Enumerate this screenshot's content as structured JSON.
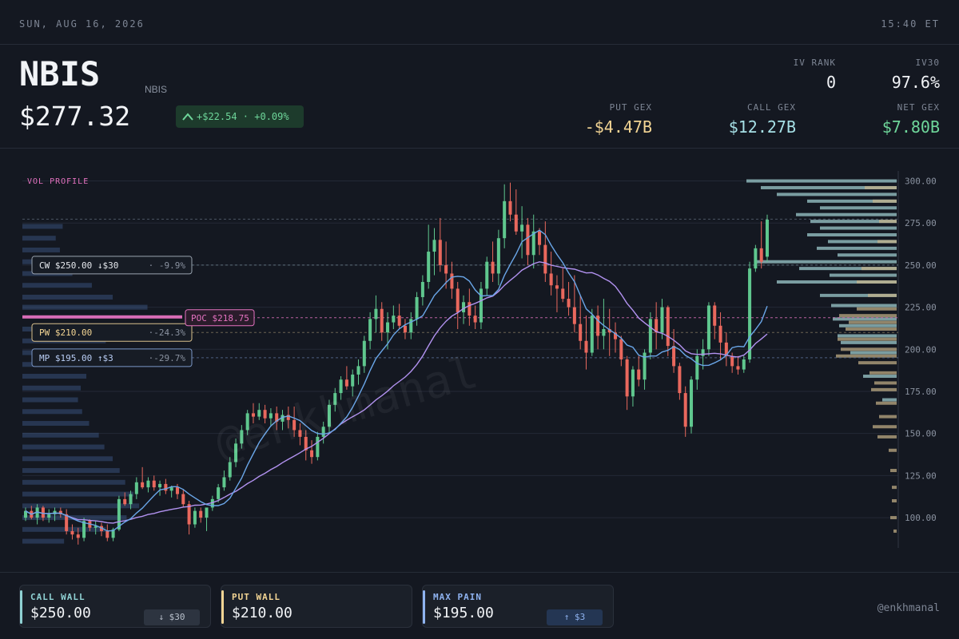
{
  "topbar": {
    "date": "SUN, AUG 16, 2026",
    "time": "15:40 ET"
  },
  "header": {
    "ticker": "NBIS",
    "subtitle": "NBIS",
    "price": "$277.32",
    "change": "+$22.54 · +0.09%",
    "stats": {
      "iv_rank": {
        "label": "IV RANK",
        "value": "0"
      },
      "iv30": {
        "label": "IV30",
        "value": "97.6%"
      },
      "put_gex": {
        "label": "PUT GEX",
        "value": "-$4.47B"
      },
      "call_gex": {
        "label": "CALL GEX",
        "value": "$12.27B"
      },
      "net_gex": {
        "label": "NET GEX",
        "value": "$7.80B"
      }
    }
  },
  "colors": {
    "up": "#5fc78e",
    "down": "#e9685d",
    "call": "#8fd1d3",
    "put": "#f3d594",
    "maxpain": "#8fb3f0",
    "poc": "#e472c0",
    "ma_fast": "#6aa6e8",
    "ma_slow": "#b292f0"
  },
  "chart_data": {
    "type": "candlestick",
    "title": "",
    "ylim": [
      82,
      305
    ],
    "yticks": [
      "300.00",
      "275.00",
      "250.00",
      "225.00",
      "200.00",
      "175.00",
      "150.00",
      "125.00",
      "100.00"
    ],
    "vol_profile_label": "VOL PROFILE",
    "levels": {
      "call_wall": {
        "label": "CW $250.00 ↓$30",
        "pct": "-9.9%",
        "value": 250
      },
      "put_wall": {
        "label": "PW $210.00",
        "pct": "-24.3%",
        "value": 210
      },
      "max_pain": {
        "label": "MP $195.00 ↑$3",
        "pct": "-29.7%",
        "value": 195
      },
      "poc": {
        "label": "POC $218.75",
        "value": 218.75
      },
      "last": 277.32
    },
    "candles": [
      [
        100,
        106,
        98,
        104
      ],
      [
        104,
        107,
        99,
        100
      ],
      [
        100,
        108,
        96,
        106
      ],
      [
        106,
        107,
        98,
        100
      ],
      [
        100,
        105,
        97,
        102
      ],
      [
        102,
        106,
        98,
        104
      ],
      [
        104,
        106,
        100,
        102
      ],
      [
        102,
        105,
        90,
        92
      ],
      [
        92,
        96,
        87,
        90
      ],
      [
        90,
        94,
        84,
        88
      ],
      [
        88,
        100,
        86,
        98
      ],
      [
        98,
        99,
        92,
        94
      ],
      [
        94,
        98,
        90,
        95
      ],
      [
        95,
        97,
        89,
        92
      ],
      [
        92,
        96,
        86,
        88
      ],
      [
        88,
        94,
        86,
        93
      ],
      [
        93,
        113,
        92,
        111
      ],
      [
        111,
        115,
        107,
        108
      ],
      [
        108,
        116,
        105,
        114
      ],
      [
        114,
        124,
        111,
        121
      ],
      [
        121,
        130,
        117,
        118
      ],
      [
        118,
        124,
        115,
        122
      ],
      [
        122,
        125,
        116,
        118
      ],
      [
        118,
        122,
        113,
        120
      ],
      [
        120,
        123,
        114,
        116
      ],
      [
        116,
        119,
        112,
        118
      ],
      [
        118,
        120,
        111,
        114
      ],
      [
        114,
        117,
        106,
        108
      ],
      [
        108,
        110,
        90,
        96
      ],
      [
        96,
        106,
        94,
        104
      ],
      [
        104,
        106,
        97,
        100
      ],
      [
        100,
        103,
        92,
        106
      ],
      [
        106,
        113,
        104,
        111
      ],
      [
        111,
        120,
        109,
        118
      ],
      [
        118,
        128,
        116,
        124
      ],
      [
        124,
        136,
        122,
        133
      ],
      [
        133,
        147,
        130,
        144
      ],
      [
        144,
        155,
        141,
        152
      ],
      [
        152,
        164,
        149,
        162
      ],
      [
        162,
        168,
        156,
        160
      ],
      [
        160,
        168,
        158,
        164
      ],
      [
        164,
        167,
        156,
        159
      ],
      [
        159,
        165,
        154,
        162
      ],
      [
        162,
        166,
        152,
        157
      ],
      [
        157,
        164,
        152,
        161
      ],
      [
        161,
        166,
        153,
        158
      ],
      [
        158,
        166,
        148,
        152
      ],
      [
        152,
        156,
        143,
        148
      ],
      [
        148,
        152,
        134,
        140
      ],
      [
        140,
        146,
        132,
        136
      ],
      [
        136,
        151,
        134,
        148
      ],
      [
        148,
        157,
        144,
        154
      ],
      [
        154,
        170,
        150,
        167
      ],
      [
        167,
        177,
        163,
        174
      ],
      [
        174,
        184,
        170,
        182
      ],
      [
        182,
        190,
        176,
        178
      ],
      [
        178,
        188,
        172,
        185
      ],
      [
        185,
        194,
        179,
        190
      ],
      [
        190,
        208,
        186,
        205
      ],
      [
        205,
        222,
        200,
        218
      ],
      [
        218,
        232,
        210,
        224
      ],
      [
        224,
        228,
        205,
        210
      ],
      [
        210,
        222,
        200,
        216
      ],
      [
        216,
        226,
        212,
        220
      ],
      [
        220,
        227,
        212,
        214
      ],
      [
        214,
        218,
        206,
        210
      ],
      [
        210,
        222,
        206,
        218
      ],
      [
        218,
        234,
        214,
        231
      ],
      [
        231,
        244,
        226,
        240
      ],
      [
        240,
        274,
        236,
        258
      ],
      [
        258,
        272,
        244,
        265
      ],
      [
        265,
        278,
        246,
        250
      ],
      [
        250,
        264,
        236,
        245
      ],
      [
        245,
        252,
        230,
        236
      ],
      [
        236,
        240,
        212,
        222
      ],
      [
        222,
        232,
        215,
        228
      ],
      [
        228,
        236,
        214,
        220
      ],
      [
        220,
        226,
        212,
        216
      ],
      [
        216,
        240,
        212,
        236
      ],
      [
        236,
        255,
        232,
        252
      ],
      [
        252,
        264,
        240,
        245
      ],
      [
        245,
        271,
        238,
        266
      ],
      [
        266,
        298,
        260,
        288
      ],
      [
        288,
        299,
        276,
        280
      ],
      [
        280,
        295,
        268,
        270
      ],
      [
        270,
        285,
        254,
        274
      ],
      [
        274,
        278,
        250,
        256
      ],
      [
        256,
        280,
        248,
        270
      ],
      [
        270,
        272,
        256,
        262
      ],
      [
        262,
        276,
        240,
        245
      ],
      [
        245,
        258,
        232,
        238
      ],
      [
        238,
        244,
        222,
        236
      ],
      [
        236,
        248,
        228,
        230
      ],
      [
        230,
        240,
        220,
        225
      ],
      [
        225,
        244,
        210,
        215
      ],
      [
        215,
        232,
        200,
        205
      ],
      [
        205,
        220,
        188,
        198
      ],
      [
        198,
        224,
        196,
        220
      ],
      [
        220,
        226,
        200,
        208
      ],
      [
        208,
        230,
        200,
        212
      ],
      [
        212,
        224,
        196,
        210
      ],
      [
        210,
        216,
        198,
        206
      ],
      [
        206,
        208,
        190,
        194
      ],
      [
        194,
        196,
        164,
        172
      ],
      [
        172,
        190,
        166,
        188
      ],
      [
        188,
        196,
        178,
        182
      ],
      [
        182,
        200,
        176,
        198
      ],
      [
        198,
        222,
        194,
        218
      ],
      [
        218,
        228,
        200,
        210
      ],
      [
        210,
        230,
        206,
        225
      ],
      [
        225,
        226,
        196,
        202
      ],
      [
        202,
        212,
        186,
        190
      ],
      [
        190,
        192,
        170,
        174
      ],
      [
        174,
        178,
        148,
        154
      ],
      [
        154,
        184,
        150,
        182
      ],
      [
        182,
        200,
        176,
        196
      ],
      [
        196,
        206,
        188,
        200
      ],
      [
        200,
        228,
        196,
        226
      ],
      [
        226,
        228,
        206,
        214
      ],
      [
        214,
        222,
        194,
        204
      ],
      [
        204,
        210,
        190,
        196
      ],
      [
        196,
        198,
        186,
        190
      ],
      [
        190,
        196,
        185,
        188
      ],
      [
        188,
        196,
        186,
        194
      ],
      [
        194,
        252,
        192,
        248
      ],
      [
        248,
        262,
        246,
        260
      ],
      [
        260,
        276,
        248,
        252
      ],
      [
        255,
        280,
        252,
        277
      ]
    ],
    "volume_profile_left": [
      [
        300,
        0
      ],
      [
        291,
        0
      ],
      [
        282,
        0
      ],
      [
        273,
        58
      ],
      [
        266,
        48
      ],
      [
        259,
        54
      ],
      [
        252,
        64
      ],
      [
        245,
        72
      ],
      [
        238,
        100
      ],
      [
        231,
        130
      ],
      [
        225,
        180
      ],
      [
        218.75,
        230
      ],
      [
        212,
        150
      ],
      [
        205,
        120
      ],
      [
        198,
        108
      ],
      [
        191,
        96
      ],
      [
        184,
        92
      ],
      [
        177,
        84
      ],
      [
        170,
        80
      ],
      [
        163,
        86
      ],
      [
        156,
        96
      ],
      [
        149,
        110
      ],
      [
        142,
        118
      ],
      [
        135,
        130
      ],
      [
        128,
        140
      ],
      [
        121,
        148
      ],
      [
        114,
        160
      ],
      [
        107,
        168
      ],
      [
        100,
        150
      ],
      [
        93,
        120
      ],
      [
        86,
        60
      ]
    ],
    "volume_profile_right": {
      "calls": [
        [
          300,
          188
        ],
        [
          296,
          170
        ],
        [
          292,
          150
        ],
        [
          288,
          112
        ],
        [
          284,
          96
        ],
        [
          280,
          126
        ],
        [
          276,
          108
        ],
        [
          272,
          96
        ],
        [
          268,
          112
        ],
        [
          264,
          86
        ],
        [
          260,
          100
        ],
        [
          256,
          74
        ],
        [
          252,
          178
        ],
        [
          248,
          122
        ],
        [
          244,
          84
        ],
        [
          240,
          150
        ],
        [
          232,
          96
        ],
        [
          226,
          82
        ],
        [
          218,
          80
        ],
        [
          214,
          72
        ],
        [
          208,
          74
        ],
        [
          204,
          70
        ],
        [
          198,
          58
        ],
        [
          184,
          42
        ],
        [
          170,
          18
        ]
      ],
      "puts": [
        [
          296,
          40
        ],
        [
          288,
          30
        ],
        [
          276,
          22
        ],
        [
          264,
          24
        ],
        [
          248,
          44
        ],
        [
          240,
          50
        ],
        [
          232,
          36
        ],
        [
          224,
          50
        ],
        [
          220,
          72
        ],
        [
          216,
          60
        ],
        [
          212,
          64
        ],
        [
          206,
          74
        ],
        [
          200,
          70
        ],
        [
          196,
          76
        ],
        [
          192,
          48
        ],
        [
          186,
          34
        ],
        [
          180,
          28
        ],
        [
          176,
          32
        ],
        [
          168,
          26
        ],
        [
          160,
          22
        ],
        [
          154,
          30
        ],
        [
          148,
          24
        ],
        [
          140,
          10
        ],
        [
          128,
          8
        ],
        [
          118,
          6
        ],
        [
          110,
          6
        ],
        [
          100,
          8
        ],
        [
          92,
          4
        ]
      ]
    }
  },
  "footer": {
    "cards": [
      {
        "label": "CALL WALL",
        "value": "$250.00",
        "pill": "↓ $30"
      },
      {
        "label": "PUT WALL",
        "value": "$210.00",
        "pill": ""
      },
      {
        "label": "MAX PAIN",
        "value": "$195.00",
        "pill": "↑ $3"
      }
    ],
    "credit": "@enkhmanal"
  },
  "watermark": "@enkhmanal"
}
